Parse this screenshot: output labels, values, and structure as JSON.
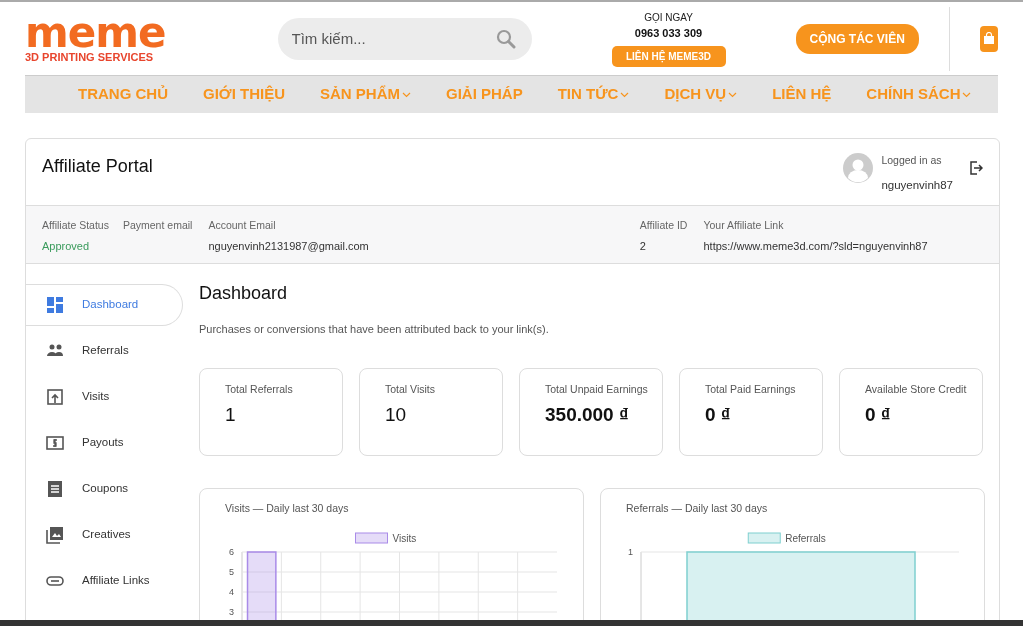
{
  "header": {
    "logo": {
      "wordmark": "meme",
      "tagline": "3D PRINTING SERVICES"
    },
    "search": {
      "placeholder": "Tìm kiếm..."
    },
    "call": {
      "label": "GỌI NGAY",
      "phone": "0963 033 309",
      "button": "LIÊN HỆ MEME3D"
    },
    "cta_button": "CỘNG TÁC VIÊN"
  },
  "nav": [
    {
      "label": "TRANG CHỦ",
      "has_dropdown": false
    },
    {
      "label": "GIỚI THIỆU",
      "has_dropdown": false
    },
    {
      "label": "SẢN PHẨM",
      "has_dropdown": true
    },
    {
      "label": "GIẢI PHÁP",
      "has_dropdown": false
    },
    {
      "label": "TIN TỨC",
      "has_dropdown": true
    },
    {
      "label": "DỊCH VỤ",
      "has_dropdown": true
    },
    {
      "label": "LIÊN HỆ",
      "has_dropdown": false
    },
    {
      "label": "CHÍNH SÁCH",
      "has_dropdown": true
    }
  ],
  "portal": {
    "title": "Affiliate Portal",
    "logged_in_label": "Logged in as",
    "username": "nguyenvinh87",
    "info": [
      {
        "label": "Affiliate Status",
        "value": "Approved",
        "kind": "status"
      },
      {
        "label": "Payment email",
        "kind": "text"
      },
      {
        "label": "Account Email",
        "value": "nguyenvinh2131987@gmail.com",
        "kind": "text"
      },
      {
        "label": "Affiliate ID",
        "value": "2",
        "kind": "text"
      },
      {
        "label": "Your Affiliate Link",
        "value": "https://www.meme3d.com/?sld=nguyenvinh87",
        "kind": "text"
      }
    ]
  },
  "sidebar": {
    "items": [
      {
        "label": "Dashboard",
        "selected": true
      },
      {
        "label": "Referrals",
        "selected": false
      },
      {
        "label": "Visits",
        "selected": false
      },
      {
        "label": "Payouts",
        "selected": false
      },
      {
        "label": "Coupons",
        "selected": false
      },
      {
        "label": "Creatives",
        "selected": false
      },
      {
        "label": "Affiliate Links",
        "selected": false
      }
    ]
  },
  "dashboard": {
    "title": "Dashboard",
    "description": "Purchases or conversions that have been attributed back to your link(s).",
    "stats": [
      {
        "label": "Total Referrals",
        "value": "1",
        "kind": "count"
      },
      {
        "label": "Total Visits",
        "value": "10",
        "kind": "count"
      },
      {
        "label": "Total Unpaid Earnings",
        "value": "350.000 ₫",
        "kind": "money"
      },
      {
        "label": "Total Paid Earnings",
        "value": "0 ₫",
        "kind": "money"
      },
      {
        "label": "Available Store Credit",
        "value": "0 ₫",
        "kind": "money"
      }
    ],
    "charts": [
      {
        "kind": "chart",
        "chart_data": {
          "type": "bar",
          "title": "Visits — Daily last 30 days",
          "yticks": [
            3,
            4,
            5,
            6
          ],
          "ylim": [
            0,
            6
          ],
          "grid": true,
          "series": [
            {
              "name": "Visits",
              "color": "#a98be8",
              "values": [
                6,
                null,
                null,
                null,
                null,
                null,
                null,
                null
              ]
            }
          ]
        }
      },
      {
        "kind": "sketch",
        "title": "Referrals — Daily last 30 days",
        "legend": "Referrals",
        "axis_label": "1"
      }
    ]
  }
}
